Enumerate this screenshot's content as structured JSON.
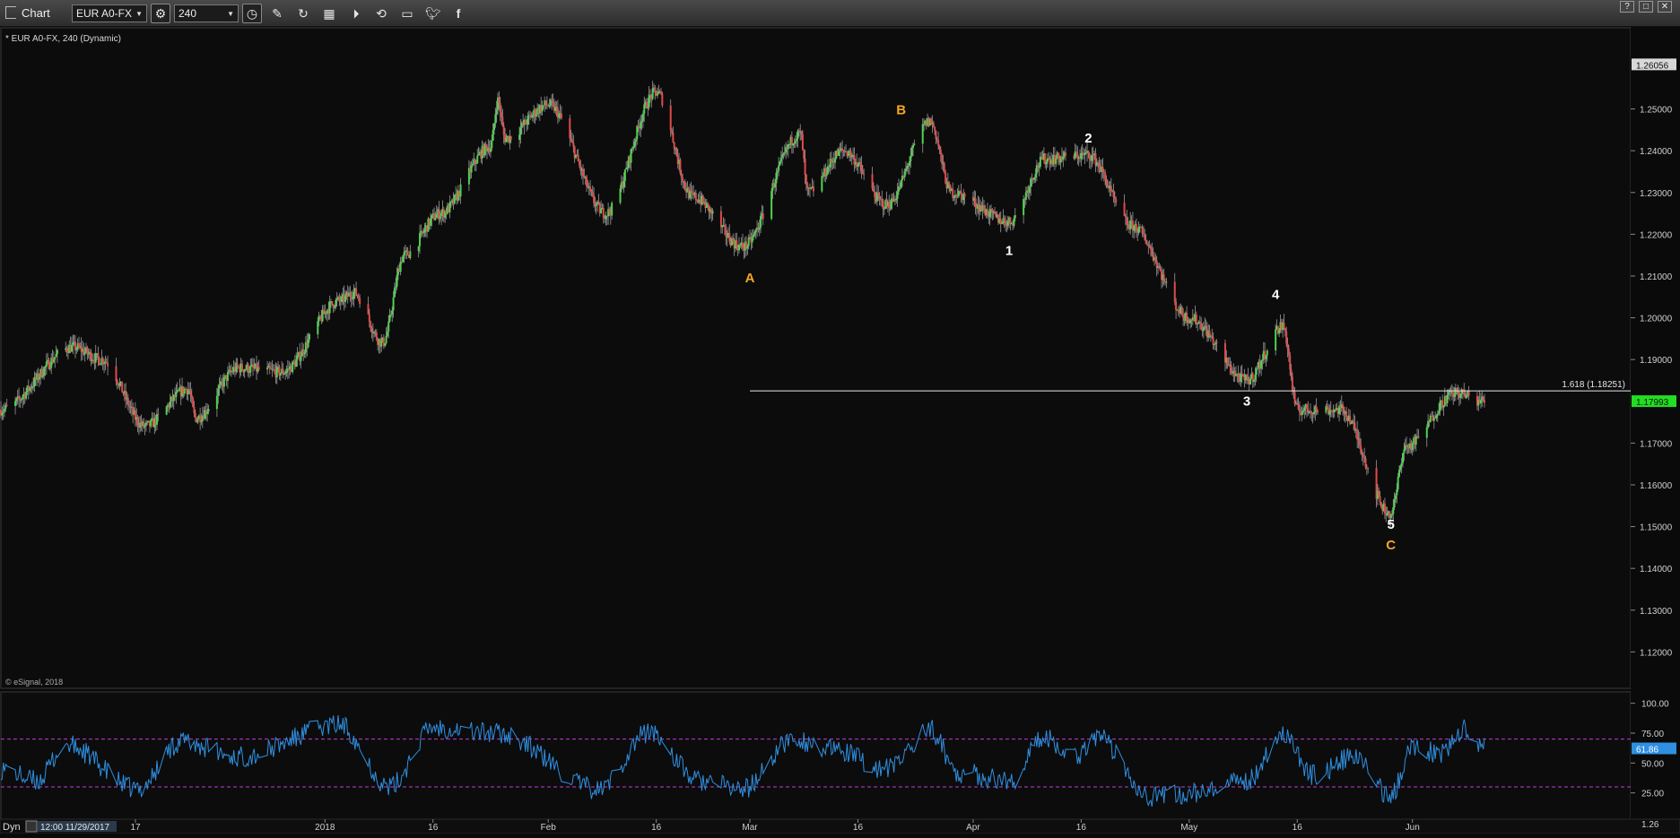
{
  "toolbar": {
    "title": "Chart",
    "symbol": "EUR A0-FX",
    "interval": "240",
    "icons": [
      "settings-gear-icon",
      "clock-icon",
      "pencil-icon",
      "refresh-icon",
      "calendar-icon",
      "play-icon",
      "replay-icon",
      "comment-icon",
      "twitter-icon",
      "facebook-icon"
    ],
    "window_buttons": [
      "?",
      "□",
      "✕"
    ]
  },
  "chart_data": [
    {
      "type": "candlestick",
      "title": "* EUR A0-FX, 240 (Dynamic)",
      "watermark": "© eSignal, 2018",
      "ylim": [
        1.113,
        1.2675
      ],
      "y_ticks": [
        "1.25000",
        "1.24000",
        "1.23000",
        "1.22000",
        "1.21000",
        "1.20000",
        "1.19000",
        "1.17000",
        "1.16000",
        "1.15000",
        "1.14000",
        "1.13000",
        "1.12000"
      ],
      "top_price_label": "1.26056",
      "last_price_label": "1.17993",
      "last_price": 1.17993,
      "x_ticks": [
        "17",
        "2018",
        "16",
        "Feb",
        "16",
        "Mar",
        "16",
        "Apr",
        "16",
        "May",
        "16",
        "Jun"
      ],
      "anchors": [
        {
          "date": "2017-11-17",
          "price": 1.178
        },
        {
          "date": "2017-11-27",
          "price": 1.193
        },
        {
          "date": "2017-12-01",
          "price": 1.19
        },
        {
          "date": "2017-12-07",
          "price": 1.174
        },
        {
          "date": "2017-12-13",
          "price": 1.183
        },
        {
          "date": "2017-12-14",
          "price": 1.176
        },
        {
          "date": "2017-12-20",
          "price": 1.188
        },
        {
          "date": "2017-12-26",
          "price": 1.187
        },
        {
          "date": "2018-01-03",
          "price": 1.204
        },
        {
          "date": "2018-01-05",
          "price": 1.206
        },
        {
          "date": "2018-01-09",
          "price": 1.194
        },
        {
          "date": "2018-01-12",
          "price": 1.215
        },
        {
          "date": "2018-01-17",
          "price": 1.225
        },
        {
          "date": "2018-01-24",
          "price": 1.241
        },
        {
          "date": "2018-01-25",
          "price": 1.252
        },
        {
          "date": "2018-01-26",
          "price": 1.243
        },
        {
          "date": "2018-02-01",
          "price": 1.251
        },
        {
          "date": "2018-02-09",
          "price": 1.225
        },
        {
          "date": "2018-02-16",
          "price": 1.254
        },
        {
          "date": "2018-02-21",
          "price": 1.229
        },
        {
          "date": "2018-02-28",
          "price": 1.217
        },
        {
          "date": "2018-03-08",
          "price": 1.244
        },
        {
          "date": "2018-03-09",
          "price": 1.23
        },
        {
          "date": "2018-03-14",
          "price": 1.24
        },
        {
          "date": "2018-03-20",
          "price": 1.227
        },
        {
          "date": "2018-03-26",
          "price": 1.247
        },
        {
          "date": "2018-03-29",
          "price": 1.23
        },
        {
          "date": "2018-04-06",
          "price": 1.223
        },
        {
          "date": "2018-04-11",
          "price": 1.238
        },
        {
          "date": "2018-04-17",
          "price": 1.239
        },
        {
          "date": "2018-04-23",
          "price": 1.222
        },
        {
          "date": "2018-05-01",
          "price": 1.2
        },
        {
          "date": "2018-05-09",
          "price": 1.185
        },
        {
          "date": "2018-05-14",
          "price": 1.198
        },
        {
          "date": "2018-05-16",
          "price": 1.178
        },
        {
          "date": "2018-05-22",
          "price": 1.178
        },
        {
          "date": "2018-05-29",
          "price": 1.153
        },
        {
          "date": "2018-05-31",
          "price": 1.169
        },
        {
          "date": "2018-06-07",
          "price": 1.182
        },
        {
          "date": "2018-06-11",
          "price": 1.18
        }
      ],
      "wave_labels": [
        {
          "text": "A",
          "date": "2018-03-01",
          "price": 1.2085,
          "color": "#f5a623"
        },
        {
          "text": "B",
          "date": "2018-03-22",
          "price": 1.2487,
          "color": "#f5a623"
        },
        {
          "text": "1",
          "date": "2018-04-06",
          "price": 1.215,
          "color": "#ffffff"
        },
        {
          "text": "2",
          "date": "2018-04-17",
          "price": 1.242,
          "color": "#ffffff"
        },
        {
          "text": "3",
          "date": "2018-05-09",
          "price": 1.179,
          "color": "#ffffff"
        },
        {
          "text": "4",
          "date": "2018-05-13",
          "price": 1.2045,
          "color": "#ffffff"
        },
        {
          "text": "5",
          "date": "2018-05-29",
          "price": 1.1495,
          "color": "#ffffff"
        },
        {
          "text": "C",
          "date": "2018-05-29",
          "price": 1.1445,
          "color": "#f5a623"
        }
      ],
      "horizontal_line": {
        "price": 1.18251,
        "label": "1.618 (1.18251)",
        "start_date": "2018-03-01"
      }
    },
    {
      "type": "line",
      "ylim": [
        0,
        105
      ],
      "y_ticks": [
        "100.00",
        "75.00",
        "50.00",
        "25.00"
      ],
      "bottom_label": "1.26",
      "last_value_label": "61.86",
      "last_value": 61.86,
      "levels": [
        70,
        30
      ],
      "anchors": [
        {
          "date": "2017-11-17",
          "value": 45
        },
        {
          "date": "2017-11-22",
          "value": 35
        },
        {
          "date": "2017-11-26",
          "value": 65
        },
        {
          "date": "2017-12-06",
          "value": 28
        },
        {
          "date": "2017-12-12",
          "value": 68
        },
        {
          "date": "2017-12-20",
          "value": 55
        },
        {
          "date": "2018-01-03",
          "value": 82
        },
        {
          "date": "2018-01-10",
          "value": 30
        },
        {
          "date": "2018-01-16",
          "value": 80
        },
        {
          "date": "2018-01-25",
          "value": 75
        },
        {
          "date": "2018-02-08",
          "value": 28
        },
        {
          "date": "2018-02-15",
          "value": 76
        },
        {
          "date": "2018-02-22",
          "value": 35
        },
        {
          "date": "2018-02-28",
          "value": 28
        },
        {
          "date": "2018-03-07",
          "value": 70
        },
        {
          "date": "2018-03-13",
          "value": 60
        },
        {
          "date": "2018-03-20",
          "value": 45
        },
        {
          "date": "2018-03-26",
          "value": 78
        },
        {
          "date": "2018-03-30",
          "value": 42
        },
        {
          "date": "2018-04-06",
          "value": 35
        },
        {
          "date": "2018-04-11",
          "value": 72
        },
        {
          "date": "2018-04-15",
          "value": 55
        },
        {
          "date": "2018-04-18",
          "value": 72
        },
        {
          "date": "2018-04-26",
          "value": 22
        },
        {
          "date": "2018-05-03",
          "value": 25
        },
        {
          "date": "2018-05-09",
          "value": 35
        },
        {
          "date": "2018-05-14",
          "value": 75
        },
        {
          "date": "2018-05-18",
          "value": 40
        },
        {
          "date": "2018-05-24",
          "value": 55
        },
        {
          "date": "2018-05-29",
          "value": 22
        },
        {
          "date": "2018-06-01",
          "value": 65
        },
        {
          "date": "2018-06-05",
          "value": 58
        },
        {
          "date": "2018-06-08",
          "value": 78
        },
        {
          "date": "2018-06-11",
          "value": 62
        }
      ]
    }
  ],
  "status_bar": {
    "mode": "Dyn",
    "cursor_time": "12:00 11/29/2017"
  }
}
